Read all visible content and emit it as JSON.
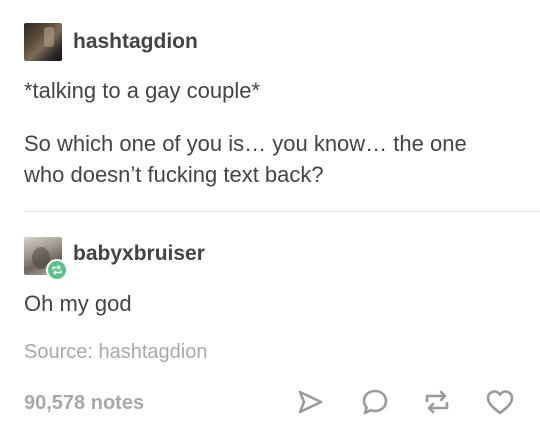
{
  "colors": {
    "text": "#444444",
    "muted": "#a8a8a8",
    "reblog_badge": "#5bbf8e",
    "divider": "#e6e6e6"
  },
  "original_post": {
    "username": "hashtagdion",
    "avatar": "user-avatar",
    "lines": [
      "*talking to a gay couple*",
      "So which one of you is… you know… the one",
      "who doesn’t fucking text back?"
    ]
  },
  "reblog": {
    "username": "babyxbruiser",
    "avatar": "user-avatar",
    "badge_icon": "reblog-icon",
    "comment": "Oh my god"
  },
  "source": "Source: hashtagdion",
  "footer": {
    "notes": "90,578 notes",
    "actions": [
      {
        "name": "share",
        "icon": "share-icon"
      },
      {
        "name": "reply",
        "icon": "reply-icon"
      },
      {
        "name": "reblog",
        "icon": "reblog-icon"
      },
      {
        "name": "like",
        "icon": "heart-icon"
      }
    ]
  }
}
